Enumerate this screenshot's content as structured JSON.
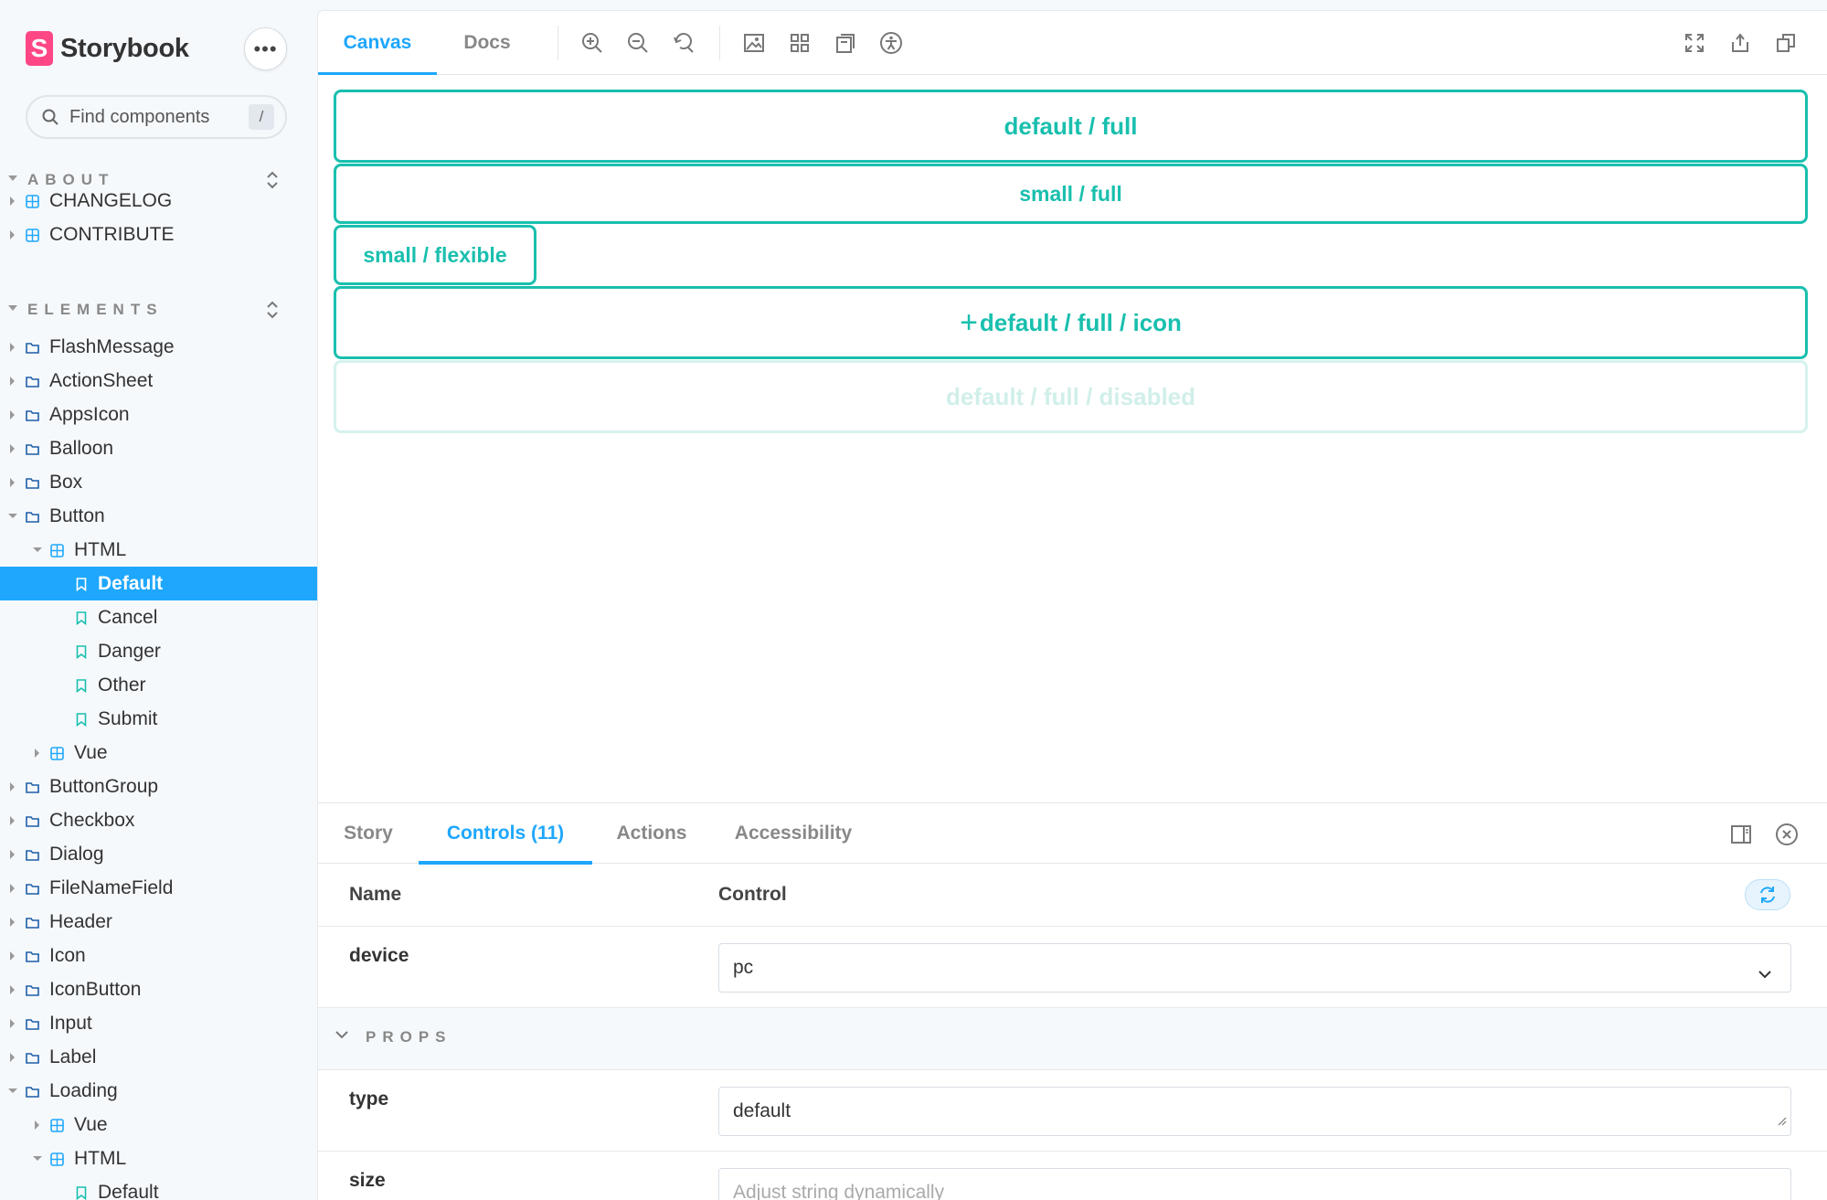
{
  "brand": {
    "name": "Storybook",
    "logo_letter": "S",
    "more_label": "•••"
  },
  "search": {
    "placeholder": "Find components",
    "shortcut": "/"
  },
  "sidebar": {
    "about": {
      "title": "ABOUT",
      "items": [
        "CHANGELOG",
        "CONTRIBUTE"
      ]
    },
    "elements": {
      "title": "ELEMENTS",
      "items": [
        {
          "label": "FlashMessage"
        },
        {
          "label": "ActionSheet"
        },
        {
          "label": "AppsIcon"
        },
        {
          "label": "Balloon"
        },
        {
          "label": "Box"
        },
        {
          "label": "Button"
        },
        {
          "label": "HTML"
        },
        {
          "label": "Default"
        },
        {
          "label": "Cancel"
        },
        {
          "label": "Danger"
        },
        {
          "label": "Other"
        },
        {
          "label": "Submit"
        },
        {
          "label": "Vue"
        },
        {
          "label": "ButtonGroup"
        },
        {
          "label": "Checkbox"
        },
        {
          "label": "Dialog"
        },
        {
          "label": "FileNameField"
        },
        {
          "label": "Header"
        },
        {
          "label": "Icon"
        },
        {
          "label": "IconButton"
        },
        {
          "label": "Input"
        },
        {
          "label": "Label"
        },
        {
          "label": "Loading"
        },
        {
          "label": "Vue"
        },
        {
          "label": "HTML"
        },
        {
          "label": "Default"
        }
      ]
    }
  },
  "toolbar": {
    "tabs": [
      {
        "label": "Canvas"
      },
      {
        "label": "Docs"
      }
    ],
    "tools": [
      "zoom-in-icon",
      "zoom-out-icon",
      "zoom-reset-icon",
      "background-icon",
      "grid-icon",
      "viewport-icon",
      "accessibility-icon"
    ],
    "right_tools": [
      "fullscreen-icon",
      "share-icon",
      "copy-link-icon"
    ]
  },
  "canvas": {
    "buttons": [
      {
        "label": "default / full"
      },
      {
        "label": "small / full"
      },
      {
        "label": "small / flexible"
      },
      {
        "label": "default / full / icon",
        "icon": "+"
      },
      {
        "label": "default / full / disabled",
        "disabled": true
      }
    ]
  },
  "panel": {
    "tabs": [
      {
        "label": "Story"
      },
      {
        "label": "Controls (11)"
      },
      {
        "label": "Actions"
      },
      {
        "label": "Accessibility"
      }
    ],
    "columns": {
      "name": "Name",
      "control": "Control"
    },
    "device": {
      "name": "device",
      "value": "pc"
    },
    "props_section": "PROPS",
    "type": {
      "name": "type",
      "value": "default"
    },
    "size": {
      "name": "size",
      "placeholder": "Adjust string dynamically"
    }
  },
  "colors": {
    "accent": "#1ea7fd",
    "brand": "#ff4785",
    "button": "#19bfae"
  }
}
